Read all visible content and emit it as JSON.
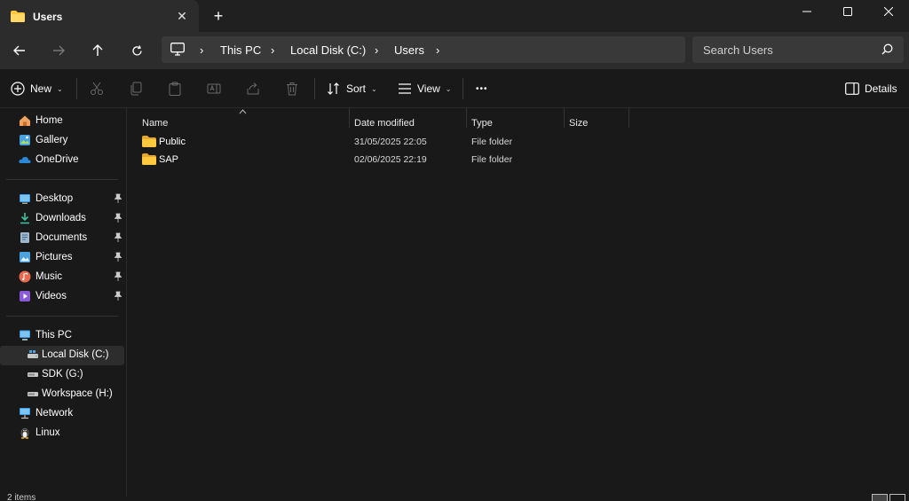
{
  "tab": {
    "title": "Users",
    "close_glyph": "✕",
    "new_tab_glyph": "+"
  },
  "window": {
    "minimize_glyph": "—",
    "close_glyph": "✕"
  },
  "breadcrumb": {
    "items": [
      "This PC",
      "Local Disk (C:)",
      "Users"
    ],
    "separator": "›"
  },
  "search": {
    "placeholder": "Search Users"
  },
  "commandbar": {
    "new_label": "New",
    "sort_label": "Sort",
    "view_label": "View",
    "more_label": "•••",
    "details_label": "Details",
    "chevron": "⌄"
  },
  "sidebar": {
    "top": [
      {
        "label": "Home",
        "icon": "home-icon"
      },
      {
        "label": "Gallery",
        "icon": "gallery-icon"
      },
      {
        "label": "OneDrive",
        "icon": "onedrive-icon"
      }
    ],
    "quick": [
      {
        "label": "Desktop",
        "icon": "desktop-icon"
      },
      {
        "label": "Downloads",
        "icon": "downloads-icon"
      },
      {
        "label": "Documents",
        "icon": "documents-icon"
      },
      {
        "label": "Pictures",
        "icon": "pictures-icon"
      },
      {
        "label": "Music",
        "icon": "music-icon"
      },
      {
        "label": "Videos",
        "icon": "videos-icon"
      }
    ],
    "this_pc": "This PC",
    "drives": [
      "Local Disk (C:)",
      "SDK (G:)",
      "Workspace (H:)"
    ],
    "network": "Network",
    "linux": "Linux"
  },
  "columns": {
    "name": "Name",
    "date": "Date modified",
    "type": "Type",
    "size": "Size"
  },
  "files": [
    {
      "name": "Public",
      "date": "31/05/2025 22:05",
      "type": "File folder"
    },
    {
      "name": "SAP",
      "date": "02/06/2025 22:19",
      "type": "File folder"
    }
  ],
  "status": {
    "text": "2 items"
  },
  "colors": {
    "accent": "#4cc2ff",
    "folder": "#ffc83d",
    "background": "#191919"
  }
}
